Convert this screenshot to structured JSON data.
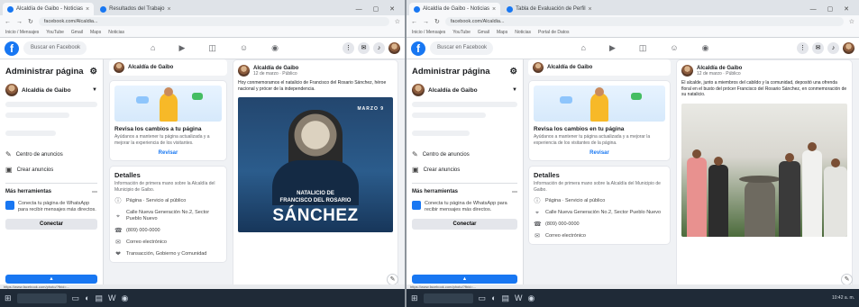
{
  "colors": {
    "fb_blue": "#1877f2",
    "page_bg": "#f0f2f5",
    "taskbar": "#1f2a37"
  },
  "left": {
    "tabs": [
      {
        "label": "Alcaldía de Gaibo - Noticias",
        "active": true
      },
      {
        "label": "Resultados del Trabajo",
        "active": false
      }
    ],
    "window_controls": "— ▢ ✕",
    "url": "facebook.com/Alcaldia...",
    "bookmarks": [
      "Inicio / Mensajes",
      "YouTube",
      "Gmail",
      "Maps",
      "Noticias"
    ],
    "search_placeholder": "Buscar en Facebook",
    "admin_title": "Administrar página",
    "page_name": "Alcaldía de Gaibo",
    "menu": [
      "Centro de anuncios",
      "Crear anuncios"
    ],
    "section_header": "Más herramientas",
    "promo_text": "Conecta tu página de WhatsApp para recibir mensajes más directos.",
    "promo_button": "Conectar",
    "page_header": "Alcaldía de Gaibo",
    "card_title": "Revisa los cambios a tu página",
    "card_text": "Ayúdanos a mantener tu página actualizada y a mejorar la experiencia de los visitantes.",
    "card_link": "Revisar",
    "details_title": "Detalles",
    "details_intro": "Información de primera mano sobre la Alcaldía del Municipio de Gaibo.",
    "details_rows": [
      {
        "icon": "info-icon",
        "text": "Página · Servicio al público"
      },
      {
        "icon": "location-icon",
        "text": "Calle Nueva Generación No.2, Sector Pueblo Nuevo"
      },
      {
        "icon": "phone-icon",
        "text": "(809) 000-0000"
      },
      {
        "icon": "mail-icon",
        "text": "Correo electrónico"
      },
      {
        "icon": "heart-icon",
        "text": "Transacción, Gobierno y Comunidad"
      }
    ],
    "post_author": "Alcaldía de Gaibo",
    "post_meta": "12 de marzo · Público",
    "post_text": "Hoy conmemoramos el natalicio de Francisco del Rosario Sánchez, héroe nacional y prócer de la independencia.",
    "poster_tag": "MARZO 9",
    "poster_line1": "NATALICIO DE",
    "poster_line2": "FRANCISCO DEL ROSARIO",
    "poster_line3": "SÁNCHEZ",
    "status_text": "https://www.facebook.com/photo/?fbid=..."
  },
  "right": {
    "tabs": [
      {
        "label": "Alcaldía de Gaibo - Noticias",
        "active": true
      },
      {
        "label": "Tabla de Evaluación de Perfil",
        "active": false
      }
    ],
    "window_controls": "— ▢ ✕",
    "url": "facebook.com/Alcaldia...",
    "bookmarks": [
      "Inicio / Mensajes",
      "YouTube",
      "Gmail",
      "Maps",
      "Noticias",
      "Portal de Datos"
    ],
    "search_placeholder": "Buscar en Facebook",
    "admin_title": "Administrar página",
    "page_name": "Alcaldía de Gaibo",
    "menu": [
      "Centro de anuncios",
      "Crear anuncios"
    ],
    "section_header": "Más herramientas",
    "promo_text": "Conecta tu página de WhatsApp para recibir mensajes más directos.",
    "promo_button": "Conectar",
    "page_header": "Alcaldía de Gaibo",
    "card_title": "Revisa los cambios en tu página",
    "card_text": "Ayúdanos a mantener tu página actualizada y a mejorar la experiencia de los visitantes de la página.",
    "card_link": "Revisar",
    "details_title": "Detalles",
    "details_intro": "Información de primera mano sobre la Alcaldía del Municipio de Gaibo.",
    "details_rows": [
      {
        "icon": "info-icon",
        "text": "Página · Servicio al público"
      },
      {
        "icon": "location-icon",
        "text": "Calle Nueva Generación No.2, Sector Pueblo Nuevo"
      },
      {
        "icon": "phone-icon",
        "text": "(809) 000-0000"
      },
      {
        "icon": "mail-icon",
        "text": "Correo electrónico"
      }
    ],
    "post_author": "Alcaldía de Gaibo",
    "post_meta": "12 de marzo · Público",
    "post_text": "El alcalde, junto a miembros del cabildo y la comunidad, depositó una ofrenda floral en el busto del prócer Francisco del Rosario Sánchez, en conmemoración de su natalicio.",
    "status_text": "https://www.facebook.com/photo/?fbid=..."
  },
  "taskbar": {
    "tray_time": "10:42 a. m."
  }
}
